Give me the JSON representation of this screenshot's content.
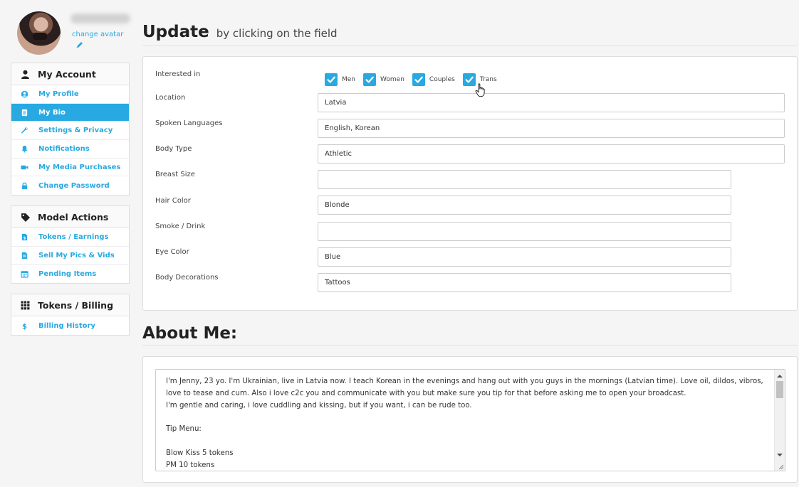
{
  "profile": {
    "change_avatar": "change avatar"
  },
  "sidebar": {
    "groups": [
      {
        "title": "My Account",
        "icon": "user-icon",
        "items": [
          {
            "label": "My Profile",
            "icon": "user-circle-icon"
          },
          {
            "label": "My Bio",
            "icon": "document-icon",
            "active": true
          },
          {
            "label": "Settings & Privacy",
            "icon": "wrench-icon"
          },
          {
            "label": "Notifications",
            "icon": "bell-icon"
          },
          {
            "label": "My Media Purchases",
            "icon": "video-camera-icon"
          },
          {
            "label": "Change Password",
            "icon": "lock-icon"
          }
        ]
      },
      {
        "title": "Model Actions",
        "icon": "tag-icon",
        "items": [
          {
            "label": "Tokens / Earnings",
            "icon": "file-dollar-icon"
          },
          {
            "label": "Sell My Pics & Vids",
            "icon": "file-icon"
          },
          {
            "label": "Pending Items",
            "icon": "calendar-icon"
          }
        ]
      },
      {
        "title": "Tokens / Billing",
        "icon": "grid-icon",
        "items": [
          {
            "label": "Billing History",
            "icon": "dollar-icon"
          }
        ]
      }
    ]
  },
  "header": {
    "title": "Update",
    "subtitle": "by clicking on the field"
  },
  "form": {
    "interested_in_label": "Interested in",
    "interests": [
      {
        "label": "Men",
        "checked": true
      },
      {
        "label": "Women",
        "checked": true
      },
      {
        "label": "Couples",
        "checked": true
      },
      {
        "label": "Trans",
        "checked": true
      }
    ],
    "fields": [
      {
        "label": "Location",
        "value": "Latvia",
        "width": "wide"
      },
      {
        "label": "Spoken Languages",
        "value": "English, Korean",
        "width": "wide"
      },
      {
        "label": "Body Type",
        "value": "Athletic",
        "width": "wide"
      },
      {
        "label": "Breast Size",
        "value": "",
        "width": "narrow"
      },
      {
        "label": "Hair Color",
        "value": "Blonde",
        "width": "narrow"
      },
      {
        "label": "Smoke / Drink",
        "value": "",
        "width": "narrow"
      },
      {
        "label": "Eye Color",
        "value": "Blue",
        "width": "narrow"
      },
      {
        "label": "Body Decorations",
        "value": "Tattoos",
        "width": "narrow"
      }
    ]
  },
  "about": {
    "title": "About Me:",
    "text": "I'm Jenny, 23 yo. I'm Ukrainian, live in Latvia now. I teach Korean in the evenings and hang out with you guys in the mornings (Latvian time). Love oil, dildos, vibros, love to tease and cum. Also i love c2c you and communicate with you but make sure you tip for that before asking me to open your broadcast.\nI'm gentle and caring, i love cuddling and kissing, but if you want, i can be rude too.\n\nTip Menu:\n\nBlow Kiss 5 tokens\nPM 10 tokens"
  },
  "colors": {
    "accent": "#29a9e1",
    "background": "#f5f5f5"
  }
}
